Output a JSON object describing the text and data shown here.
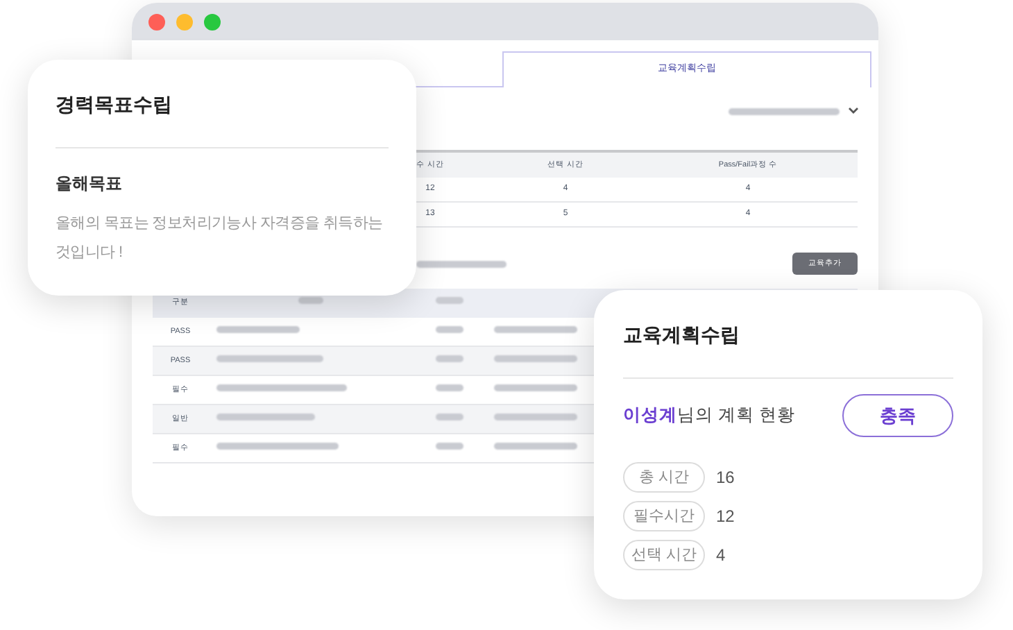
{
  "window": {
    "tabs": [
      {
        "label": "교육계획수립",
        "selected": true
      }
    ],
    "summary_table": {
      "columns": [
        "수 시간",
        "선택 시간",
        "Pass/Fail과정 수"
      ],
      "rows": [
        [
          "12",
          "4",
          "4"
        ],
        [
          "13",
          "5",
          "4"
        ]
      ]
    },
    "add_button": "교육추가",
    "course_table": {
      "columns": [
        "구분"
      ],
      "rows": [
        {
          "type": "PASS",
          "shaded": false
        },
        {
          "type": "PASS",
          "shaded": true
        },
        {
          "type": "필수",
          "shaded": false
        },
        {
          "type": "일반",
          "shaded": true
        },
        {
          "type": "필수",
          "shaded": false
        }
      ]
    }
  },
  "career_card": {
    "title": "경력목표수립",
    "subtitle": "올해목표",
    "body": "올해의 목표는 정보처리기능사 자격증을 취득하는 것입니다 !"
  },
  "plan_card": {
    "title": "교육계획수립",
    "status": "**이성계**님의 계획 현황",
    "button": "충족",
    "stats": [
      {
        "label": "총 시간",
        "value": "16"
      },
      {
        "label": "필수시간",
        "value": "12"
      },
      {
        "label": "선택 시간",
        "value": "4"
      }
    ]
  }
}
